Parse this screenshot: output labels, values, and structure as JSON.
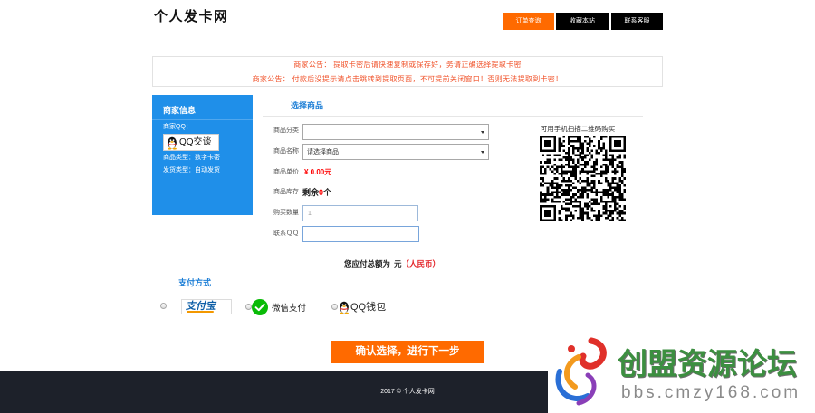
{
  "header": {
    "logo": "个人发卡网",
    "nav": [
      {
        "label": "订单查询",
        "active": true
      },
      {
        "label": "收藏本站",
        "active": false
      },
      {
        "label": "联系客服",
        "active": false
      }
    ]
  },
  "notice": {
    "lines": [
      "商家公告： 提取卡密后请快速复制或保存好，务请正确选择提取卡密",
      "商家公告： 付款后没提示请点击跳转到提取页面，不可提前关闭窗口！否则无法提取到卡密！"
    ]
  },
  "merchant": {
    "title": "商家信息",
    "qq_label": "商家QQ：",
    "qq_button": "QQ交谈",
    "product_type": "商品类型：数字卡密",
    "delivery_type": "发货类型：自动发货"
  },
  "form": {
    "title": "选择商品",
    "category_label": "商品分类",
    "product_label": "商品名称",
    "product_value": "请选择商品",
    "price_label": "商品单价",
    "price_value": "¥ 0.00元",
    "stock_label": "商品库存",
    "stock_prefix": "剩余",
    "stock_count": 0,
    "stock_suffix": "个",
    "quantity_label": "购买数量",
    "quantity_value": 1,
    "contact_label": "联系ＱＱ"
  },
  "qr": {
    "caption": "可用手机扫描二维码购买"
  },
  "total": {
    "prefix": "您应付总额为",
    "unit": "元",
    "currency": "（人民币）"
  },
  "payment": {
    "title": "支付方式",
    "options": [
      {
        "label": "支付宝",
        "icon": "alipay-logo",
        "selected": false
      },
      {
        "label": "微信支付",
        "icon": "wechat-icon",
        "selected": false
      },
      {
        "label": "QQ钱包",
        "icon": "qq-penguin-icon",
        "selected": false
      }
    ]
  },
  "submit": {
    "label": "确认选择，进行下一步"
  },
  "footer": {
    "copyright": "2017 © 个人发卡网"
  },
  "watermark": {
    "title": "创盟资源论坛",
    "url": "bbs.cmzy168.com"
  },
  "colors": {
    "accent": "#ff6a00",
    "nav_dark": "#000000",
    "panel_blue": "#1f8fe9",
    "title_blue": "#1c7ed6",
    "notice_red": "#f0532b",
    "price_red": "#ff0000",
    "total_red": "#e4262b",
    "footer_bg": "#1d212a",
    "watermark_green": "#3c8f40"
  }
}
